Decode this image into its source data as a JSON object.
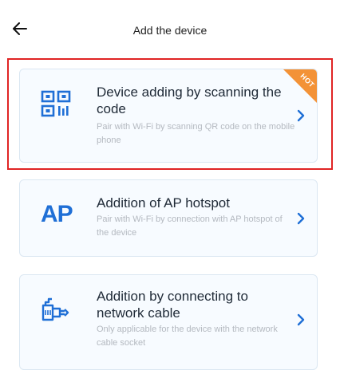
{
  "header": {
    "title": "Add the device"
  },
  "options": [
    {
      "title": "Device adding by scanning the code",
      "description": "Pair with Wi-Fi by scanning QR code on the mobile phone",
      "badge": "HOT",
      "icon": "qr-code-icon"
    },
    {
      "title": "Addition of AP hotspot",
      "description": "Pair with Wi-Fi by connection with AP hotspot of the device",
      "icon_text": "AP",
      "icon": "ap-hotspot-icon"
    },
    {
      "title": "Addition by connecting to network cable",
      "description": "Only applicable for the device with the network cable socket",
      "icon": "network-cable-icon"
    }
  ],
  "colors": {
    "accent": "#1f6fd6",
    "badge": "#f39237",
    "highlight": "#e02424"
  }
}
